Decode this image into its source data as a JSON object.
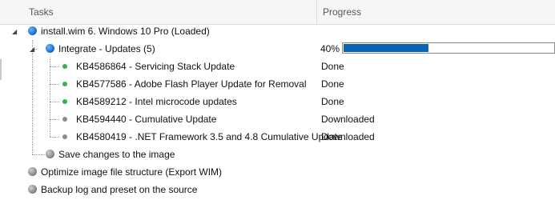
{
  "columns": {
    "tasks": "Tasks",
    "progress": "Progress"
  },
  "colors": {
    "accent": "#0b63b5",
    "done": "#3cb04a",
    "pending": "#8c8c8c"
  },
  "tree": {
    "root": {
      "label": "install.wim 6. Windows 10 Pro  (Loaded)",
      "expanded": true,
      "icon": "blue-ball-icon"
    },
    "integrate": {
      "label": "Integrate - Updates (5)",
      "expanded": true,
      "icon": "blue-ball-icon",
      "progress_text": "40%",
      "progress_value": 0.4
    },
    "updates": [
      {
        "label": "KB4586864 - Servicing Stack Update",
        "status": "Done",
        "state": "done"
      },
      {
        "label": "KB4577586 - Adobe Flash Player Update for Removal",
        "status": "Done",
        "state": "done"
      },
      {
        "label": "KB4589212 - Intel microcode updates",
        "status": "Done",
        "state": "done"
      },
      {
        "label": "KB4594440 - Cumulative Update",
        "status": "Downloaded",
        "state": "downloaded"
      },
      {
        "label": "KB4580419 - .NET Framework 3.5 and 4.8 Cumulative Update",
        "status": "Downloaded",
        "state": "downloaded"
      }
    ],
    "save_changes": {
      "label": "Save changes to the image",
      "icon": "grey-ball-icon"
    },
    "optimize": {
      "label": "Optimize image file structure (Export WIM)",
      "icon": "grey-ball-icon"
    },
    "backup": {
      "label": "Backup log and preset on the source",
      "icon": "grey-ball-icon"
    }
  }
}
